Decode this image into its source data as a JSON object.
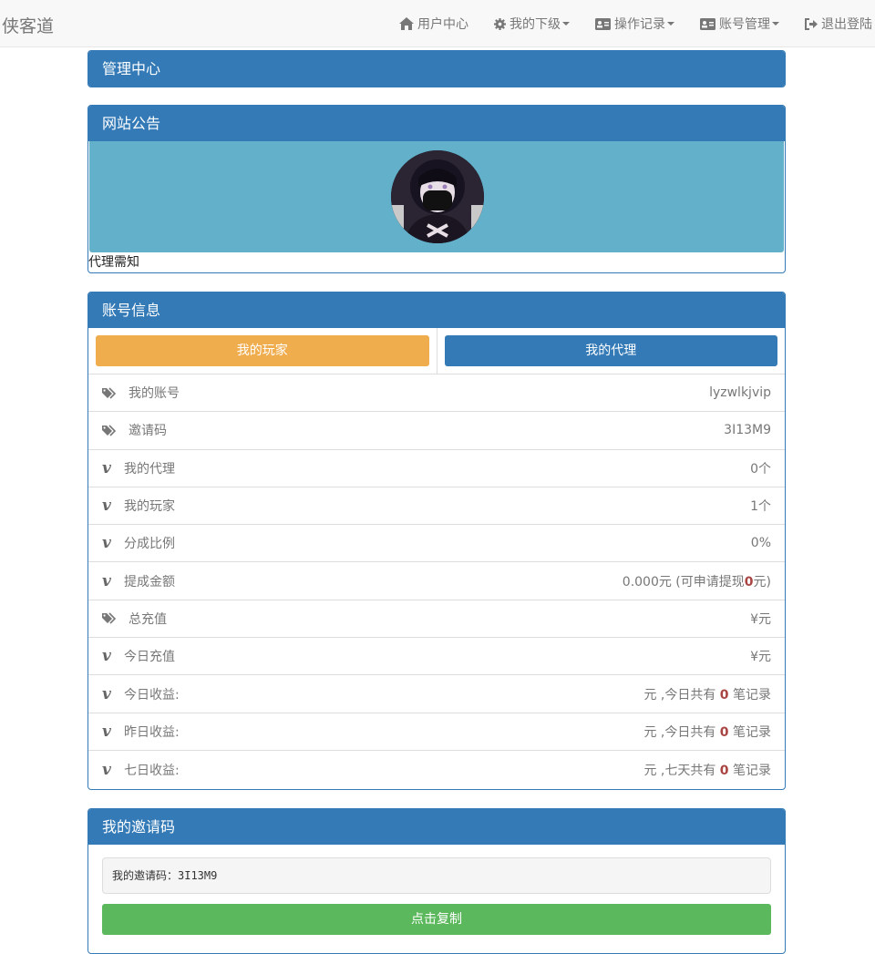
{
  "nav": {
    "brand": "侠客道",
    "items": [
      {
        "label": "用户中心",
        "icon": "home-icon",
        "dropdown": false
      },
      {
        "label": "我的下级",
        "icon": "gear-icon",
        "dropdown": true
      },
      {
        "label": "操作记录",
        "icon": "id-card-icon",
        "dropdown": true
      },
      {
        "label": "账号管理",
        "icon": "id-card-icon",
        "dropdown": true
      },
      {
        "label": "退出登陆",
        "icon": "logout-icon",
        "dropdown": false
      }
    ]
  },
  "admin_panel": {
    "title": "管理中心"
  },
  "notice_panel": {
    "title": "网站公告",
    "text": "代理需知"
  },
  "account_panel": {
    "title": "账号信息",
    "tab_players": "我的玩家",
    "tab_agents": "我的代理",
    "rows": [
      {
        "icon": "tags-icon",
        "label": "我的账号",
        "value": "lyzwlkjvip"
      },
      {
        "icon": "tags-icon",
        "label": "邀请码",
        "value": "3I13M9"
      },
      {
        "icon": "vimeo-icon",
        "label": "我的代理",
        "value": "0个"
      },
      {
        "icon": "vimeo-icon",
        "label": "我的玩家",
        "value": "1个"
      },
      {
        "icon": "vimeo-icon",
        "label": "分成比例",
        "value": "0%"
      },
      {
        "icon": "vimeo-icon",
        "label": "提成金额",
        "value_pre": "0.000元 (可申请提现",
        "value_hl": "0",
        "value_post": "元)"
      },
      {
        "icon": "tags-icon",
        "label": "总充值",
        "value": "¥元"
      },
      {
        "icon": "vimeo-icon",
        "label": "今日充值",
        "value": "¥元"
      },
      {
        "icon": "vimeo-icon",
        "label": "今日收益:",
        "value_pre": "元 ,今日共有 ",
        "value_hl": "0",
        "value_post": " 笔记录"
      },
      {
        "icon": "vimeo-icon",
        "label": "昨日收益:",
        "value_pre": "元 ,今日共有 ",
        "value_hl": "0",
        "value_post": " 笔记录"
      },
      {
        "icon": "vimeo-icon",
        "label": "七日收益:",
        "value_pre": "元 ,七天共有 ",
        "value_hl": "0",
        "value_post": " 笔记录"
      }
    ]
  },
  "invite_panel": {
    "title": "我的邀请码",
    "code_text": "我的邀请码：3I13M9",
    "copy_button": "点击复制"
  },
  "colors": {
    "primary": "#337ab7",
    "warning": "#f0ad4e",
    "success": "#5cb85c",
    "info_banner": "#63b0ca",
    "highlight": "#a94442"
  }
}
